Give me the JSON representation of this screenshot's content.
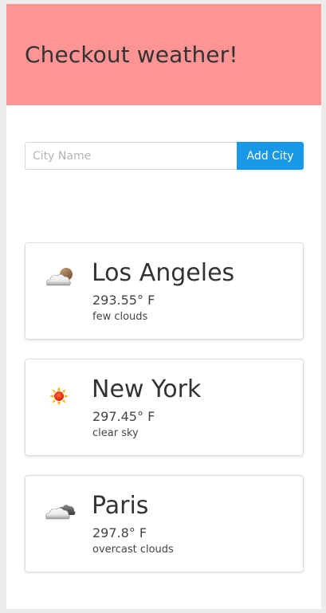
{
  "header": {
    "title": "Checkout weather!",
    "background_color": "#ff9494"
  },
  "form": {
    "placeholder": "City Name",
    "value": "",
    "button_label": "Add City",
    "button_color": "#1a98e8"
  },
  "cities": [
    {
      "name": "Los Angeles",
      "temperature": "293.55° F",
      "description": "few clouds",
      "icon": "few-clouds-icon"
    },
    {
      "name": "New York",
      "temperature": "297.45° F",
      "description": "clear sky",
      "icon": "sun-icon"
    },
    {
      "name": "Paris",
      "temperature": "297.8° F",
      "description": "overcast clouds",
      "icon": "overcast-clouds-icon"
    }
  ]
}
